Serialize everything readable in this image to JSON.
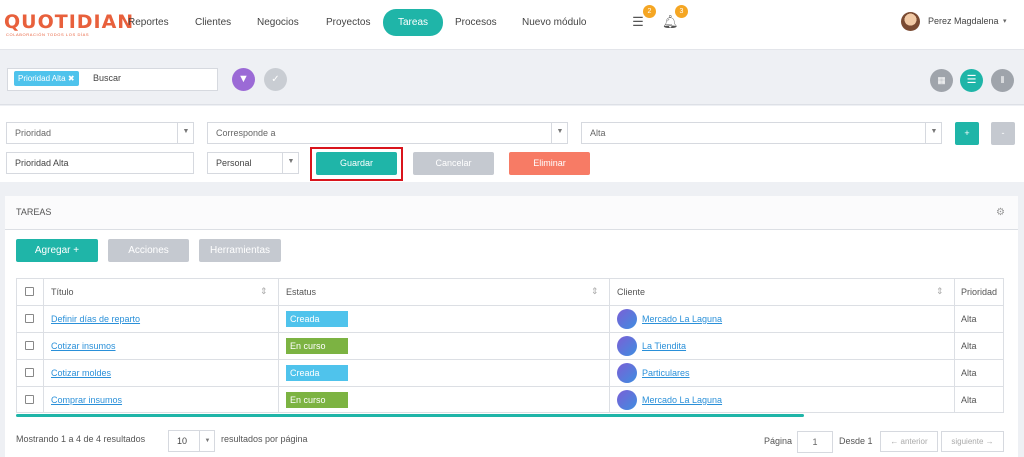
{
  "brand": {
    "name": "QUOTIDIAN",
    "tagline": "COLABORACIÓN TODOS LOS DÍAS",
    "color": "#e8603c"
  },
  "nav": {
    "items": [
      "Reportes",
      "Clientes",
      "Negocios",
      "Proyectos",
      "Tareas",
      "Procesos",
      "Nuevo módulo"
    ],
    "active": "Tareas"
  },
  "notifications": {
    "messages_count": "2",
    "bell_count": "3"
  },
  "user": {
    "name": "Perez Magdalena"
  },
  "search": {
    "chip": "Prioridad Alta",
    "placeholder": "Buscar"
  },
  "form": {
    "prioridad_placeholder": "Prioridad",
    "corresponde_placeholder": "Corresponde a",
    "alta_value": "Alta",
    "name_value": "Prioridad Alta",
    "personal_value": "Personal",
    "guardar": "Guardar",
    "cancelar": "Cancelar",
    "eliminar": "Eliminar",
    "plus": "+",
    "minus": "-"
  },
  "panel": {
    "title": "TAREAS",
    "agregar": "Agregar +",
    "acciones": "Acciones",
    "herramientas": "Herramientas"
  },
  "table": {
    "headers": [
      "Título",
      "Estatus",
      "Cliente",
      "Prioridad"
    ],
    "rows": [
      {
        "titulo": "Definir días de reparto",
        "estatus": "Creada",
        "cliente": "Mercado La Laguna",
        "prioridad": "Alta",
        "status_color": "#4fc3ec"
      },
      {
        "titulo": "Cotizar insumos",
        "estatus": "En curso",
        "cliente": "La Tiendita",
        "prioridad": "Alta",
        "status_color": "#7cb342"
      },
      {
        "titulo": "Cotizar moldes",
        "estatus": "Creada",
        "cliente": "Particulares",
        "prioridad": "Alta",
        "status_color": "#4fc3ec"
      },
      {
        "titulo": "Comprar insumos",
        "estatus": "En curso",
        "cliente": "Mercado La Laguna",
        "prioridad": "Alta",
        "status_color": "#7cb342"
      }
    ]
  },
  "footer": {
    "showing": "Mostrando 1 a 4 de 4 resultados",
    "per_page": "10",
    "per_page_label": "resultados por página",
    "pagina_label": "Página",
    "page": "1",
    "desde": "Desde 1",
    "anterior": "← anterior",
    "siguiente": "siguiente →"
  },
  "colors": {
    "accent": "#1fb5a8",
    "danger": "#f77b65",
    "muted": "#c5c9d0",
    "filter": "#9b6ad6"
  }
}
